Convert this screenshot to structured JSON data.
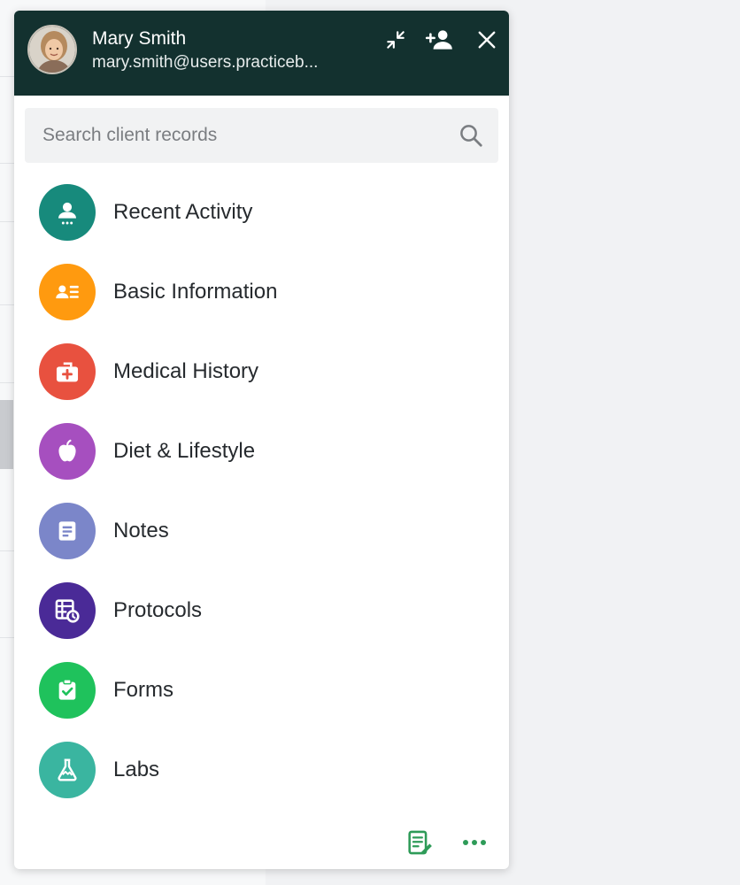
{
  "user": {
    "name": "Mary Smith",
    "email": "mary.smith@users.practiceb..."
  },
  "header_actions": [
    {
      "name": "collapse-icon"
    },
    {
      "name": "add-user-icon"
    },
    {
      "name": "close-icon"
    }
  ],
  "search": {
    "placeholder": "Search client records",
    "value": ""
  },
  "menu": {
    "items": [
      {
        "label": "Recent Activity",
        "icon": "user-activity-icon",
        "color": "#178a7c"
      },
      {
        "label": "Basic Information",
        "icon": "id-card-icon",
        "color": "#ff9a0f"
      },
      {
        "label": "Medical History",
        "icon": "medical-kit-icon",
        "color": "#e8513f"
      },
      {
        "label": "Diet & Lifestyle",
        "icon": "apple-icon",
        "color": "#a64fbf"
      },
      {
        "label": "Notes",
        "icon": "note-icon",
        "color": "#7b86c9"
      },
      {
        "label": "Protocols",
        "icon": "protocol-schedule-icon",
        "color": "#4a2a97"
      },
      {
        "label": "Forms",
        "icon": "clipboard-check-icon",
        "color": "#1fc25c"
      },
      {
        "label": "Labs",
        "icon": "flask-icon",
        "color": "#3ab5a0"
      }
    ]
  },
  "footer": {
    "actions": [
      {
        "name": "edit-note-icon",
        "color": "#2e9b58"
      },
      {
        "name": "more-icon",
        "color": "#2e9b58"
      }
    ]
  },
  "colors": {
    "header_bg": "#13312f",
    "panel_bg": "#ffffff",
    "search_bg": "#f1f2f3"
  }
}
